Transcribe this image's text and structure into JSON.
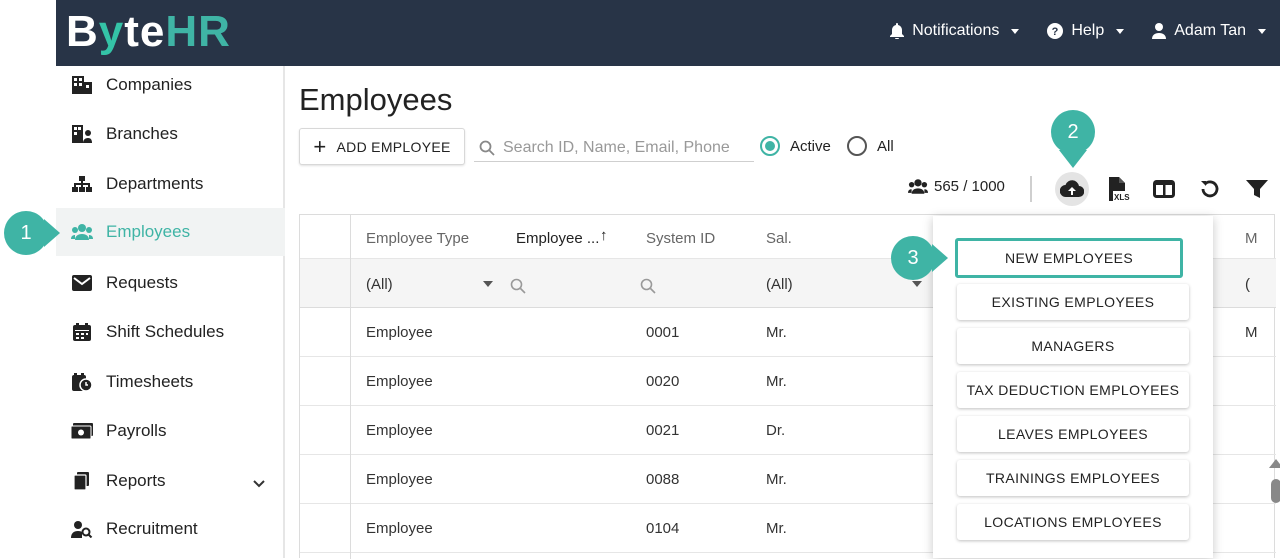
{
  "brand": {
    "logo_text": "ByteHR",
    "accent": "#3fb4a5",
    "topbar_bg": "#283447"
  },
  "topnav": {
    "notifications": "Notifications",
    "help": "Help",
    "user": "Adam Tan"
  },
  "sidebar": {
    "items": [
      {
        "label": "Companies",
        "icon": "building-icon"
      },
      {
        "label": "Branches",
        "icon": "branches-icon"
      },
      {
        "label": "Departments",
        "icon": "org-chart-icon"
      },
      {
        "label": "Employees",
        "icon": "users-icon",
        "active": true
      },
      {
        "label": "Requests",
        "icon": "envelope-icon"
      },
      {
        "label": "Shift Schedules",
        "icon": "calendar-icon"
      },
      {
        "label": "Timesheets",
        "icon": "calendar-clock-icon"
      },
      {
        "label": "Payrolls",
        "icon": "money-icon"
      },
      {
        "label": "Reports",
        "icon": "copy-icon"
      },
      {
        "label": "Recruitment",
        "icon": "user-search-icon"
      }
    ]
  },
  "main": {
    "title": "Employees",
    "add_button": "ADD EMPLOYEE",
    "search_placeholder": "Search ID, Name, Email, Phone",
    "radio_active": "Active",
    "radio_all": "All",
    "count": "565 / 1000"
  },
  "grid": {
    "headers": [
      "Employee Type",
      "Employee ...",
      "System ID",
      "Sal."
    ],
    "filters": [
      "(All)",
      "",
      "",
      "(All)"
    ],
    "rows": [
      [
        "Employee",
        "",
        "0001",
        "Mr."
      ],
      [
        "Employee",
        "",
        "0020",
        "Mr."
      ],
      [
        "Employee",
        "",
        "0021",
        "Dr."
      ],
      [
        "Employee",
        "",
        "0088",
        "Mr."
      ],
      [
        "Employee",
        "",
        "0104",
        "Mr."
      ]
    ],
    "partial_col": {
      "header": "M",
      "filter": "(",
      "row1": "M"
    }
  },
  "import_menu": {
    "items": [
      "NEW EMPLOYEES",
      "EXISTING EMPLOYEES",
      "MANAGERS",
      "TAX DEDUCTION EMPLOYEES",
      "LEAVES EMPLOYEES",
      "TRAININGS EMPLOYEES",
      "LOCATIONS EMPLOYEES"
    ]
  },
  "markers": {
    "m1": "1",
    "m2": "2",
    "m3": "3"
  }
}
